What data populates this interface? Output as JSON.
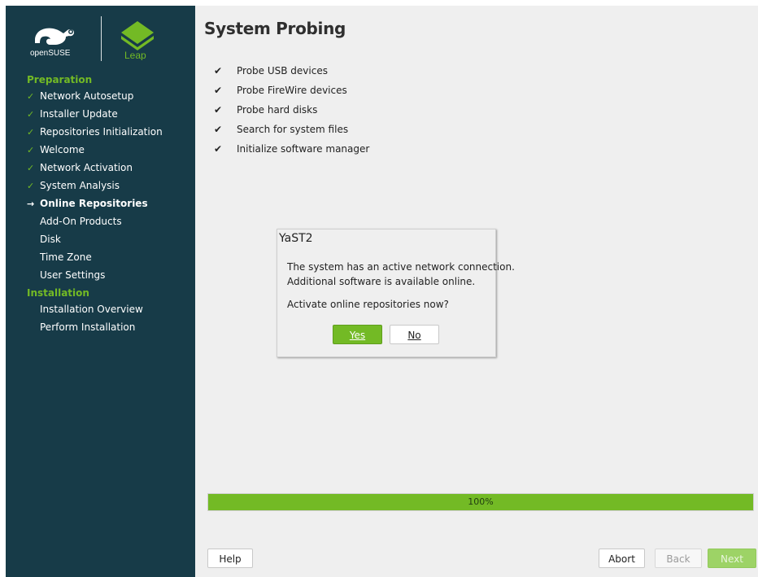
{
  "logos": {
    "opensuse_text": "openSUSE",
    "leap_text": "Leap"
  },
  "sidebar": {
    "sections": [
      {
        "heading": "Preparation",
        "items": [
          {
            "label": "Network Autosetup",
            "state": "done"
          },
          {
            "label": "Installer Update",
            "state": "done"
          },
          {
            "label": "Repositories Initialization",
            "state": "done"
          },
          {
            "label": "Welcome",
            "state": "done"
          },
          {
            "label": "Network Activation",
            "state": "done"
          },
          {
            "label": "System Analysis",
            "state": "done"
          },
          {
            "label": "Online Repositories",
            "state": "current"
          },
          {
            "label": "Add-On Products",
            "state": "pending"
          },
          {
            "label": "Disk",
            "state": "pending"
          },
          {
            "label": "Time Zone",
            "state": "pending"
          },
          {
            "label": "User Settings",
            "state": "pending"
          }
        ]
      },
      {
        "heading": "Installation",
        "items": [
          {
            "label": "Installation Overview",
            "state": "pending"
          },
          {
            "label": "Perform Installation",
            "state": "pending"
          }
        ]
      }
    ]
  },
  "main": {
    "title": "System Probing",
    "probes": [
      "Probe USB devices",
      "Probe FireWire devices",
      "Probe hard disks",
      "Search for system files",
      "Initialize software manager"
    ],
    "check_glyph": "✔"
  },
  "dialog": {
    "title": "YaST2",
    "message_line1": "The system has an active network connection.",
    "message_line2": "Additional software is available online.",
    "question": "Activate online repositories now?",
    "yes_label": "Yes",
    "no_label": "No"
  },
  "progress": {
    "label": "100%",
    "value": 1.0
  },
  "buttons": {
    "help": "Help",
    "abort": "Abort",
    "back": "Back",
    "next": "Next"
  },
  "colors": {
    "sidebar_bg": "#173b48",
    "accent_green": "#73ba25",
    "main_bg": "#efefef"
  }
}
